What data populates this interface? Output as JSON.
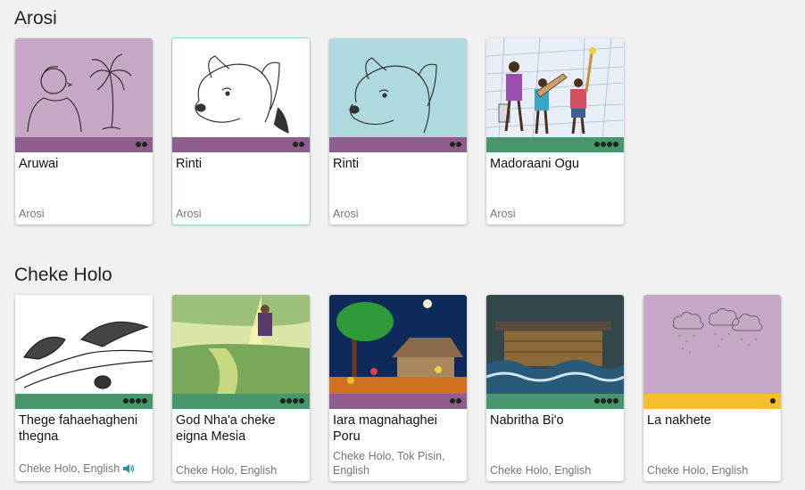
{
  "sections": [
    {
      "title": "Arosi",
      "books": [
        {
          "title": "Aruwai",
          "languages": "Arosi",
          "level": 2,
          "band_color": "#8e5f8b",
          "bg": "#c6a8c6"
        },
        {
          "title": "Rinti",
          "languages": "Arosi",
          "level": 2,
          "band_color": "#8e5f8b",
          "bg": "#ffffff"
        },
        {
          "title": "Rinti",
          "languages": "Arosi",
          "level": 2,
          "band_color": "#8e5f8b",
          "bg": "#add9df"
        },
        {
          "title": "Madoraani Ogu",
          "languages": "Arosi",
          "level": 4,
          "band_color": "#46976b",
          "bg": "#e8eef6"
        }
      ]
    },
    {
      "title": "Cheke Holo",
      "books": [
        {
          "title": "Thege fahaehagheni thegna",
          "languages": "Cheke Holo, English",
          "level": 4,
          "band_color": "#46976b",
          "bg": "#ffffff",
          "audio": true
        },
        {
          "title": "God Nha'a cheke eigna Mesia",
          "languages": "Cheke Holo, English",
          "level": 4,
          "band_color": "#46976b",
          "bg": "#d8e6a8"
        },
        {
          "title": "Iara magnahaghei Poru",
          "languages": "Cheke Holo, Tok Pisin, English",
          "level": 2,
          "band_color": "#8e5f8b",
          "bg": "#0d2a5a"
        },
        {
          "title": "Nabritha Bi'o",
          "languages": "Cheke Holo, English",
          "level": 4,
          "band_color": "#46976b",
          "bg": "#33464a"
        },
        {
          "title": "La nakhete",
          "languages": "Cheke Holo, English",
          "level": 1,
          "band_color": "#f7be2f",
          "bg": "#c6a8c6"
        }
      ]
    }
  ],
  "icons": {
    "audio": "speaker-icon"
  }
}
